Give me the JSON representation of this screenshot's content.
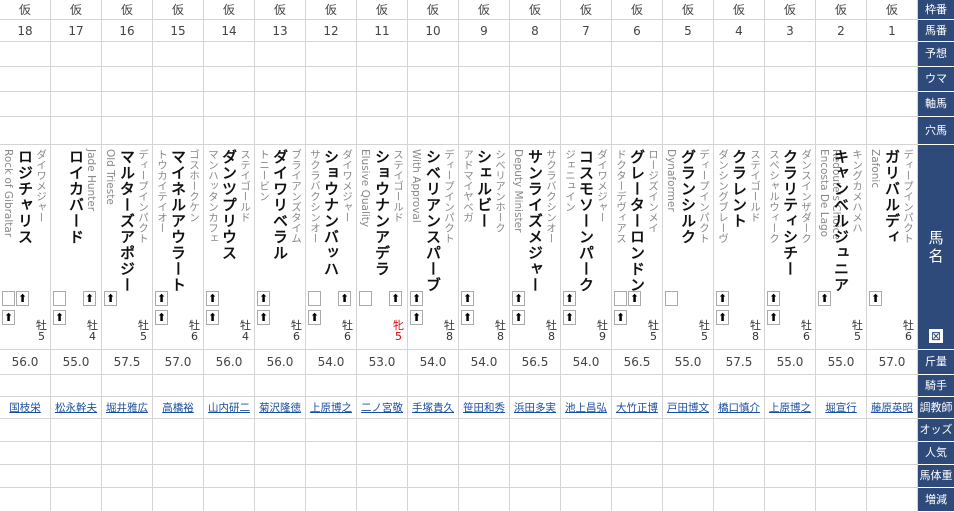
{
  "row_headers": {
    "waku": "枠番",
    "umaban": "馬番",
    "yoso": "予想",
    "uma": "ウマ",
    "jiku": "軸馬",
    "ana": "穴馬",
    "name": "馬\n名",
    "weight": "斤量",
    "jockey": "騎手",
    "trainer": "調教師",
    "odds": "オッズ",
    "ninki": "人気",
    "bataiju": "馬体重",
    "zogen": "増減"
  },
  "horses": [
    {
      "waku": "仮",
      "num": "18",
      "father": "ダイワメジャー",
      "name": "ロジチャリス",
      "mother_sire": "Rock of Gibraltar",
      "sex_age": "牡\n5",
      "female": false,
      "weight": "56.0",
      "trainer": "国枝栄"
    },
    {
      "waku": "仮",
      "num": "17",
      "father": "Jade Hunter",
      "name": "ロイカバード",
      "mother_sire": "",
      "sex_age": "牡\n4",
      "female": false,
      "weight": "55.0",
      "trainer": "松永幹夫"
    },
    {
      "waku": "仮",
      "num": "16",
      "father": "ディープインパクト",
      "name": "マルターズアポジー",
      "mother_sire": "Old Trieste",
      "sex_age": "牡\n5",
      "female": false,
      "weight": "57.5",
      "trainer": "堀井雅広"
    },
    {
      "waku": "仮",
      "num": "15",
      "father": "ゴスホークケン",
      "name": "マイネルアウラート",
      "mother_sire": "トウカイテイオー",
      "sex_age": "牡\n6",
      "female": false,
      "weight": "57.0",
      "trainer": "高橋裕"
    },
    {
      "waku": "仮",
      "num": "14",
      "father": "ステイゴールド",
      "name": "ダンツプリウス",
      "mother_sire": "マンハッタンカフェ",
      "sex_age": "牡\n4",
      "female": false,
      "weight": "56.0",
      "trainer": "山内研二"
    },
    {
      "waku": "仮",
      "num": "13",
      "father": "ブライアンズタイム",
      "name": "ダイワリベラル",
      "mother_sire": "トニービン",
      "sex_age": "牡\n6",
      "female": false,
      "weight": "56.0",
      "trainer": "菊沢隆徳"
    },
    {
      "waku": "仮",
      "num": "12",
      "father": "ダイワメジャー",
      "name": "ショウナンバッハ",
      "mother_sire": "サクラバクシンオー",
      "sex_age": "牡\n6",
      "female": false,
      "weight": "54.0",
      "trainer": "上原博之"
    },
    {
      "waku": "仮",
      "num": "11",
      "father": "ステイゴールド",
      "name": "ショウナンアデラ",
      "mother_sire": "Elusive Quality",
      "sex_age": "牝\n5",
      "female": true,
      "weight": "53.0",
      "trainer": "二ノ宮敬"
    },
    {
      "waku": "仮",
      "num": "10",
      "father": "ディープインパクト",
      "name": "シベリアンスパーブ",
      "mother_sire": "With Approval",
      "sex_age": "牡\n8",
      "female": false,
      "weight": "54.0",
      "trainer": "手塚貴久"
    },
    {
      "waku": "仮",
      "num": "9",
      "father": "シベリアンホーク",
      "name": "シェルビー",
      "mother_sire": "アドマイヤベガ",
      "sex_age": "牡\n8",
      "female": false,
      "weight": "54.0",
      "trainer": "笹田和秀"
    },
    {
      "waku": "仮",
      "num": "8",
      "father": "サクラバクシンオー",
      "name": "サンライズメジャー",
      "mother_sire": "Deputy Minister",
      "sex_age": "牡\n8",
      "female": false,
      "weight": "56.5",
      "trainer": "浜田多実"
    },
    {
      "waku": "仮",
      "num": "7",
      "father": "ダイワメジャー",
      "name": "コスモソーンパーク",
      "mother_sire": "ジェニュイン",
      "sex_age": "牡\n9",
      "female": false,
      "weight": "54.0",
      "trainer": "池上昌弘"
    },
    {
      "waku": "仮",
      "num": "6",
      "father": "ロージズインメイ",
      "name": "グレーターロンドン",
      "mother_sire": "ドクターデヴィアス",
      "sex_age": "牡\n5",
      "female": false,
      "weight": "56.5",
      "trainer": "大竹正博"
    },
    {
      "waku": "仮",
      "num": "5",
      "father": "ディープインパクト",
      "name": "グランシルク",
      "mother_sire": "Dynaformer",
      "sex_age": "牡\n5",
      "female": false,
      "weight": "55.0",
      "trainer": "戸田博文"
    },
    {
      "waku": "仮",
      "num": "4",
      "father": "ステイゴールド",
      "name": "クラレント",
      "mother_sire": "ダンシングブレーヴ",
      "sex_age": "牡\n8",
      "female": false,
      "weight": "57.5",
      "trainer": "橋口慎介"
    },
    {
      "waku": "仮",
      "num": "3",
      "father": "ダンスインザダーク",
      "name": "クラリティシチー",
      "mother_sire": "スペシャルウィーク",
      "sex_age": "牡\n6",
      "female": false,
      "weight": "55.0",
      "trainer": "上原博之"
    },
    {
      "waku": "仮",
      "num": "2",
      "father": "キングカメハメハ",
      "name": "キャンベルジュニア",
      "mother_sire": "Redoute's Choice",
      "mother_sire2": "Encosta De Lago",
      "sex_age": "牡\n5",
      "female": false,
      "weight": "55.0",
      "trainer": "堀宣行"
    },
    {
      "waku": "仮",
      "num": "1",
      "father": "ディープインパクト",
      "name": "ガリバルディ",
      "mother_sire": "Zafonic",
      "sex_age": "牡\n6",
      "female": false,
      "weight": "57.0",
      "trainer": "藤原英昭"
    }
  ],
  "arrow": "⬆",
  "toggle_icon": "⊠"
}
